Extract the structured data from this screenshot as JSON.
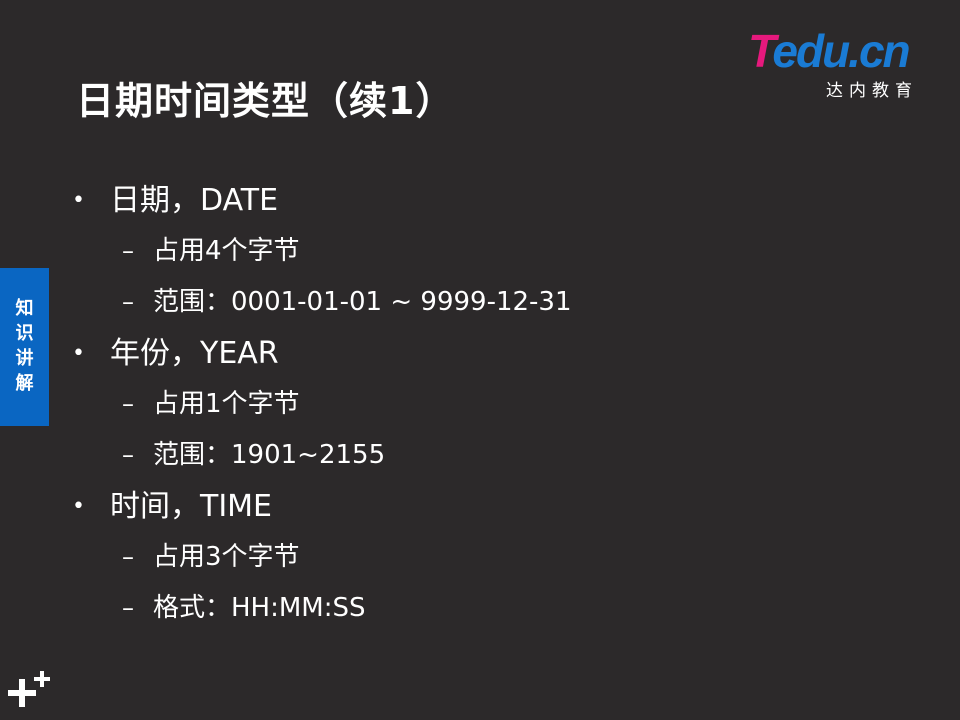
{
  "slide": {
    "title": "日期时间类型（续1）",
    "logo": {
      "brand_t": "T",
      "brand_rest": "edu.cn",
      "subtitle": "达内教育"
    },
    "side_tab": {
      "chars": [
        "知",
        "识",
        "讲",
        "解"
      ]
    },
    "bullet_marker": "•",
    "dash_marker": "–",
    "items": [
      {
        "level": 1,
        "text": "日期，DATE"
      },
      {
        "level": 2,
        "text": "占用4个字节"
      },
      {
        "level": 2,
        "text": "范围：0001-01-01 ~ 9999-12-31"
      },
      {
        "level": 1,
        "text": "年份，YEAR"
      },
      {
        "level": 2,
        "text": "占用1个字节"
      },
      {
        "level": 2,
        "text": "范围：1901~2155"
      },
      {
        "level": 1,
        "text": "时间，TIME"
      },
      {
        "level": 2,
        "text": "占用3个字节"
      },
      {
        "level": 2,
        "text": "格式：HH:MM:SS"
      }
    ],
    "decor_icon": "plus-cross-icon"
  },
  "colors": {
    "background": "#2c292a",
    "text": "#ffffff",
    "side_tab": "#0a66c2",
    "logo_pink": "#e6197d",
    "logo_blue": "#1a7bd4"
  }
}
